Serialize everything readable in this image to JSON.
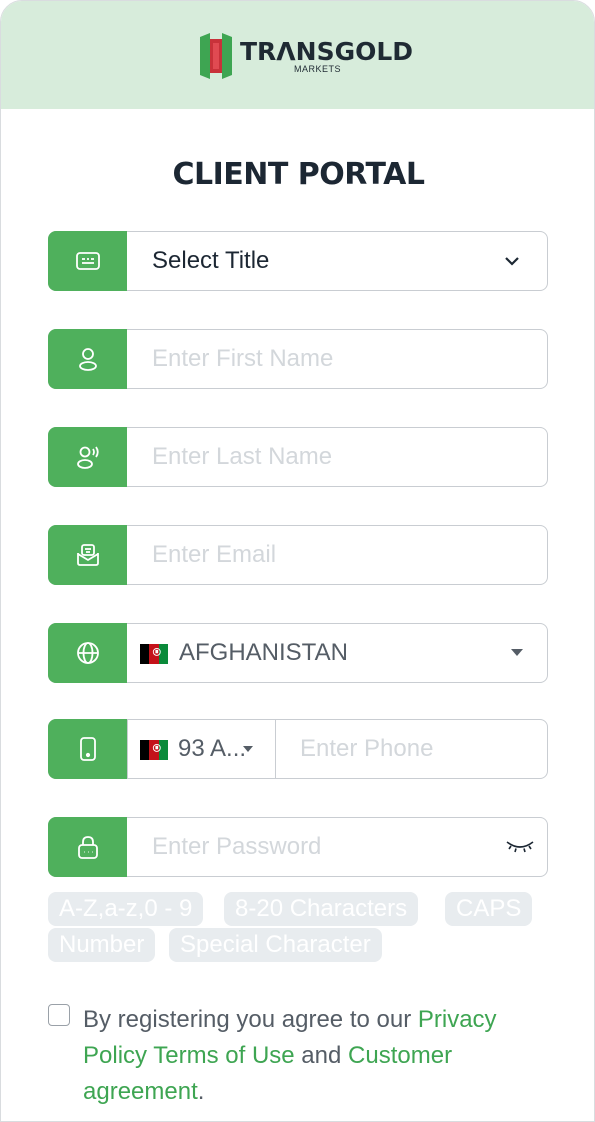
{
  "brand": {
    "name": "TRANSGOLD",
    "name_display": "TRΛNSGOLD",
    "sub": "MARKETS",
    "color_green": "#4fb05c",
    "color_header_bg": "#d7ecdb"
  },
  "page_title": "CLIENT PORTAL",
  "form": {
    "title_select": {
      "value": "Select Title",
      "icon": "id-card-icon"
    },
    "first_name": {
      "placeholder": "Enter First Name",
      "icon": "user-icon"
    },
    "last_name": {
      "placeholder": "Enter Last Name",
      "icon": "user-voice-icon"
    },
    "email": {
      "placeholder": "Enter Email",
      "icon": "email-icon"
    },
    "country": {
      "value": "AFGHANISTAN",
      "icon": "globe-icon"
    },
    "phone": {
      "code": "93 A...",
      "placeholder": "Enter Phone",
      "icon": "phone-icon"
    },
    "password": {
      "placeholder": "Enter Password",
      "icon": "lock-icon"
    }
  },
  "password_rules": [
    "A-Z,a-z,0 - 9",
    "8-20 Characters",
    "CAPS",
    "Number",
    "Special Character"
  ],
  "agreement": {
    "prefix": "By registering you agree to our ",
    "privacy_link": "Privacy Policy",
    "terms_link": "Terms of Use",
    "and": " and ",
    "customer_link": "Customer agreement",
    "suffix": "."
  }
}
